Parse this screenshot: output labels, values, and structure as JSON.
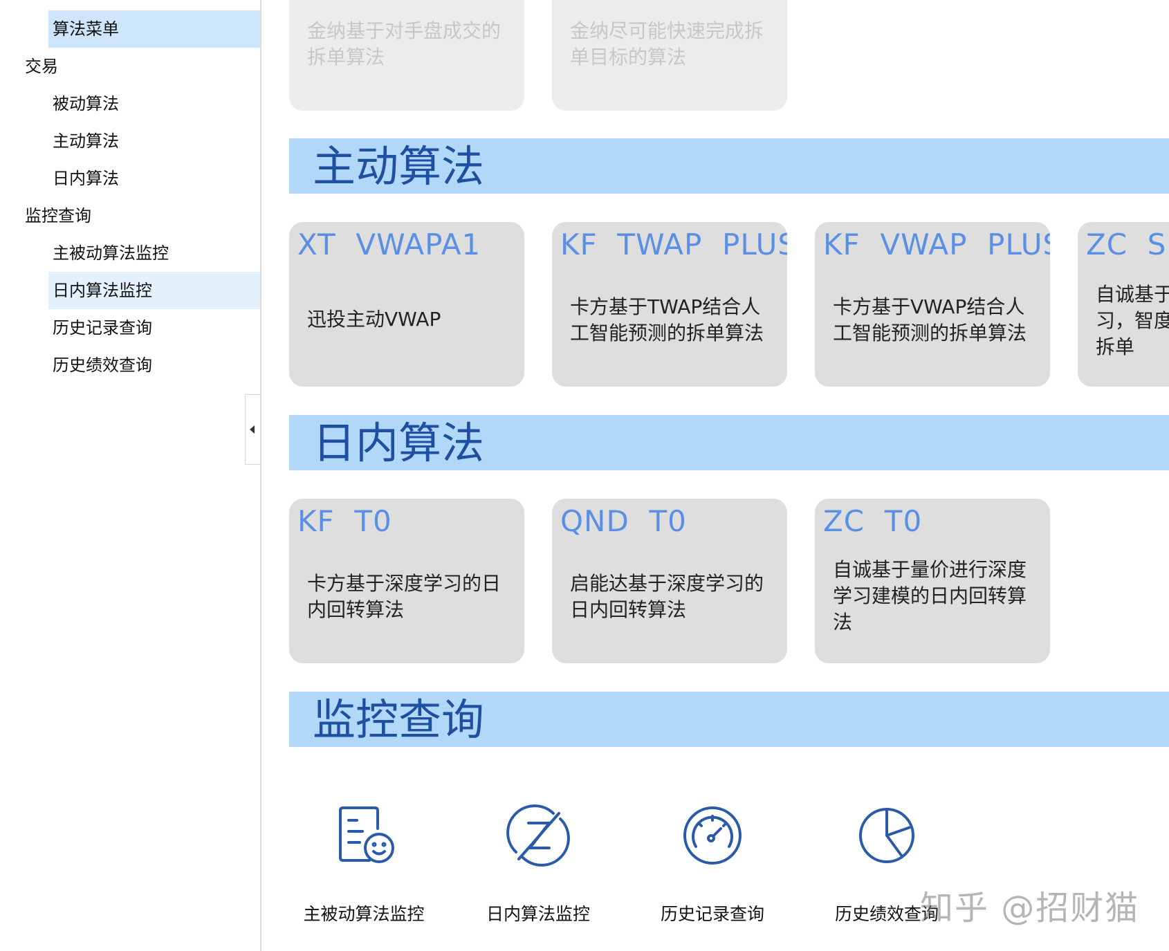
{
  "sidebar": {
    "items": [
      {
        "label": "算法菜单"
      },
      {
        "label": "交易"
      },
      {
        "label": "被动算法"
      },
      {
        "label": "主动算法"
      },
      {
        "label": "日内算法"
      },
      {
        "label": "监控查询"
      },
      {
        "label": "主被动算法监控"
      },
      {
        "label": "日内算法监控"
      },
      {
        "label": "历史记录查询"
      },
      {
        "label": "历史绩效查询"
      }
    ]
  },
  "passive_cards": [
    {
      "desc": "金纳基于对手盘成交的拆单算法"
    },
    {
      "desc": "金纳尽可能快速完成拆单目标的算法"
    }
  ],
  "sections": {
    "active": {
      "title": "主动算法"
    },
    "intraday": {
      "title": "日内算法"
    },
    "monitor": {
      "title": "监控查询"
    }
  },
  "active_cards": [
    {
      "code": "XT  VWAPA1",
      "desc": "迅投主动VWAP"
    },
    {
      "code": "KF  TWAP  PLUS",
      "desc": "卡方基于TWAP结合人工智能预测的拆单算法"
    },
    {
      "code": "KF  VWAP  PLUS",
      "desc": "卡方基于VWAP结合人工智能预测的拆单算法"
    },
    {
      "code": "ZC  SM",
      "desc": "自诚基于学习，智度的拆单"
    }
  ],
  "intraday_cards": [
    {
      "code": "KF  T0",
      "desc": "卡方基于深度学习的日内回转算法"
    },
    {
      "code": "QND  T0",
      "desc": "启能达基于深度学习的日内回转算法"
    },
    {
      "code": "ZC  T0",
      "desc": "自诚基于量价进行深度学习建模的日内回转算法"
    }
  ],
  "monitor_items": [
    {
      "label": "主被动算法监控",
      "icon": "report-smile-icon"
    },
    {
      "label": "日内算法监控",
      "icon": "z-circle-icon"
    },
    {
      "label": "历史记录查询",
      "icon": "gauge-icon"
    },
    {
      "label": "历史绩效查询",
      "icon": "pie-chart-icon"
    }
  ],
  "watermark": "知乎 @招财猫",
  "colors": {
    "section_bg": "#b2d8f9",
    "section_title": "#1f4fa0",
    "card_code": "#5a8fe6",
    "card_bg": "#dedede",
    "icon": "#2a5aa8",
    "nav_selected": "#cde6fb"
  }
}
